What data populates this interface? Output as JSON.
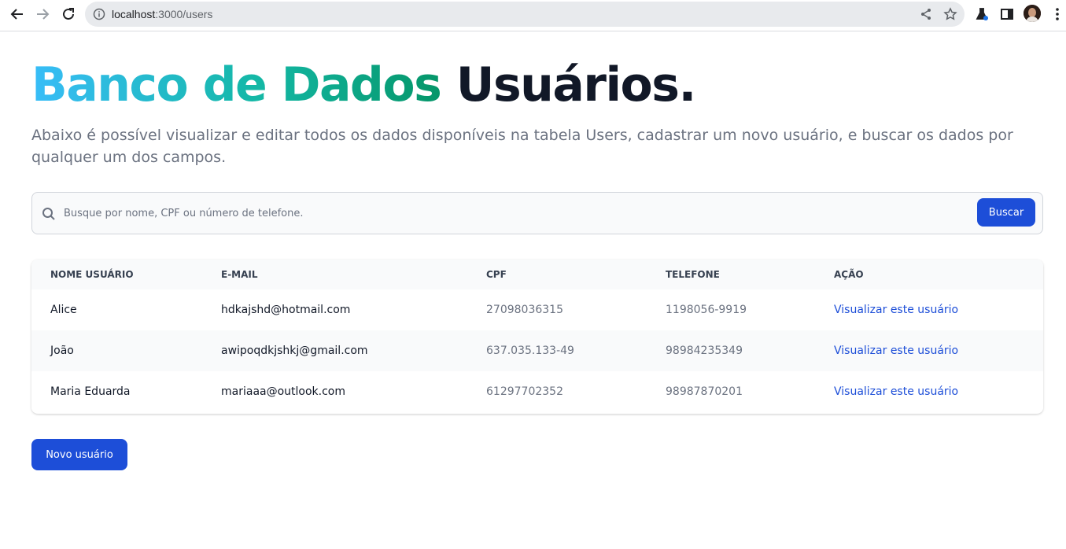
{
  "browser": {
    "url_host": "localhost",
    "url_path": ":3000/users"
  },
  "hero": {
    "title_gradient": "Banco de Dados",
    "title_dark": "Usuários.",
    "description": "Abaixo é possível visualizar e editar todos os dados disponíveis na tabela Users, cadastrar um novo usuário, e buscar os dados por qualquer um dos campos."
  },
  "search": {
    "placeholder": "Busque por nome, CPF ou número de telefone.",
    "value": "",
    "button_label": "Buscar"
  },
  "table": {
    "headers": [
      "Nome usuário",
      "E-mail",
      "CPF",
      "Telefone",
      "Ação"
    ],
    "rows": [
      {
        "name": "Alice",
        "email": "hdkajshd@hotmail.com",
        "cpf": "27098036315",
        "phone": "1198056-9919",
        "action": "Visualizar este usuário"
      },
      {
        "name": "João",
        "email": "awipoqdkjshkj@gmail.com",
        "cpf": "637.035.133-49",
        "phone": "98984235349",
        "action": "Visualizar este usuário"
      },
      {
        "name": "Maria Eduarda",
        "email": "mariaaa@outlook.com",
        "cpf": "61297702352",
        "phone": "98987870201",
        "action": "Visualizar este usuário"
      }
    ]
  },
  "new_user_button": "Novo usuário",
  "icons": {
    "back": "arrow-left-icon",
    "forward": "arrow-right-icon",
    "reload": "reload-icon",
    "site_info": "info-icon",
    "share": "share-icon",
    "bookmark": "star-icon",
    "extension": "flask-icon",
    "side_panel": "side-panel-icon",
    "menu": "kebab-menu-icon",
    "search": "search-icon"
  },
  "colors": {
    "primary": "#1d4ed8",
    "gradient_start": "#38bdf8",
    "gradient_end": "#059669",
    "title_dark": "#111827",
    "muted_text": "#6b7280"
  }
}
